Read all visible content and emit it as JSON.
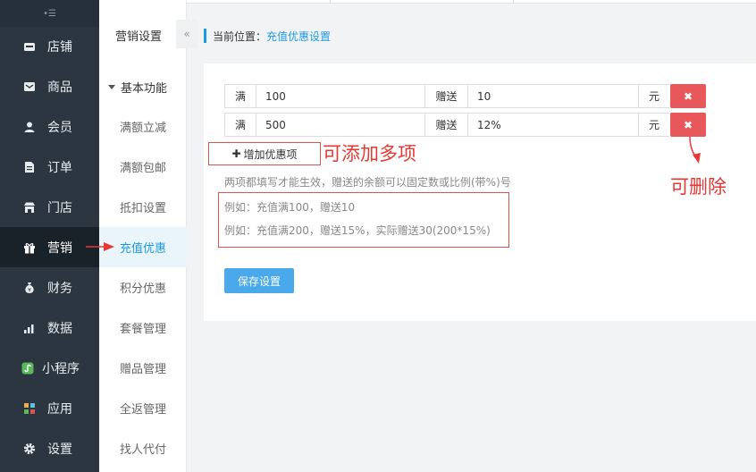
{
  "sidebar": {
    "toggle_icon": "•☰",
    "items": [
      {
        "label": "店铺",
        "icon": "store-icon"
      },
      {
        "label": "商品",
        "icon": "goods-icon"
      },
      {
        "label": "会员",
        "icon": "member-icon"
      },
      {
        "label": "订单",
        "icon": "order-icon"
      },
      {
        "label": "门店",
        "icon": "shop-icon"
      },
      {
        "label": "营销",
        "icon": "gift-icon",
        "active": true
      },
      {
        "label": "财务",
        "icon": "money-bag-icon"
      },
      {
        "label": "数据",
        "icon": "bar-chart-icon"
      },
      {
        "label": "小程序",
        "icon": "mini-program-icon"
      },
      {
        "label": "应用",
        "icon": "apps-icon"
      },
      {
        "label": "设置",
        "icon": "gear-icon"
      }
    ]
  },
  "submenu": {
    "title": "营销设置",
    "collapse_label": "«",
    "group": "基本功能",
    "items": [
      {
        "label": "满额立减"
      },
      {
        "label": "满额包邮"
      },
      {
        "label": "抵扣设置"
      },
      {
        "label": "充值优惠",
        "active": true
      },
      {
        "label": "积分优惠"
      },
      {
        "label": "套餐管理"
      },
      {
        "label": "赠品管理"
      },
      {
        "label": "全返管理"
      },
      {
        "label": "找人代付"
      }
    ]
  },
  "breadcrumb": {
    "prefix": "当前位置：",
    "current": "充值优惠设置"
  },
  "form": {
    "rows": [
      {
        "prefix": "满",
        "amount": "100",
        "label": "赠送",
        "bonus": "10",
        "unit": "元",
        "delete_label": "✖"
      },
      {
        "prefix": "满",
        "amount": "500",
        "label": "赠送",
        "bonus": "12%",
        "unit": "元",
        "delete_label": "✖"
      }
    ],
    "add_label": "增加优惠项",
    "add_plus": "✚",
    "hint": "两项都填写才能生效，赠送的余额可以固定数或比例(带%)号",
    "example1": "例如：充值满100，赠送10",
    "example2": "例如：充值满200，赠送15%，实际赠送30(200*15%)",
    "save_label": "保存设置"
  },
  "annotations": {
    "add_note": "可添加多项",
    "delete_note": "可删除",
    "color": "#e53935"
  },
  "colors": {
    "sidebar_bg": "#2b3641",
    "accent": "#1c9ae0",
    "delete": "#e8575a",
    "save": "#4aa9ea"
  }
}
